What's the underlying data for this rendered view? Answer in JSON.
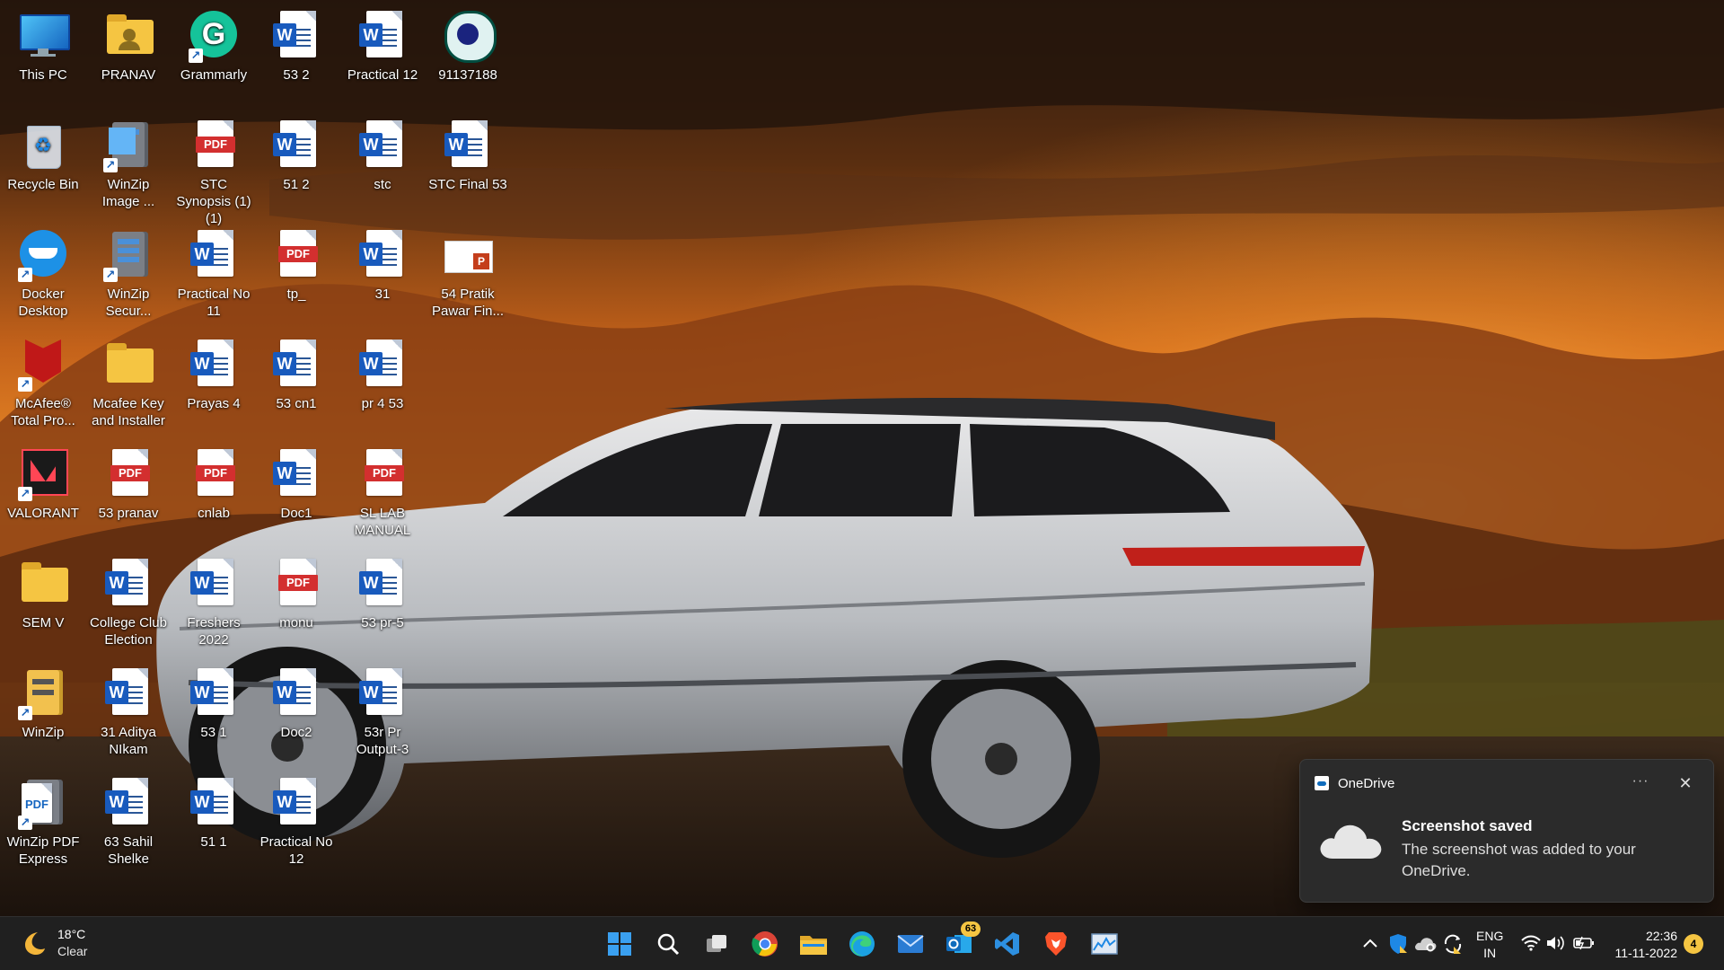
{
  "desktop": {
    "icons": [
      {
        "label": "This PC",
        "kind": "monitor-icon"
      },
      {
        "label": "PRANAV",
        "kind": "user-folder-icon"
      },
      {
        "label": "Grammarly",
        "kind": "grammarly-icon"
      },
      {
        "label": "53 2",
        "kind": "word-icon"
      },
      {
        "label": "Practical  12",
        "kind": "word-icon"
      },
      {
        "label": "91137188",
        "kind": "badge-image-icon"
      },
      {
        "label": "Recycle Bin",
        "kind": "recycle-bin-icon"
      },
      {
        "label": "WinZip Image ...",
        "kind": "winzip-image-icon"
      },
      {
        "label": "STC Synopsis (1) (1)",
        "kind": "pdf-icon"
      },
      {
        "label": "51 2",
        "kind": "word-icon"
      },
      {
        "label": "stc",
        "kind": "word-icon"
      },
      {
        "label": "STC Final 53",
        "kind": "word-icon"
      },
      {
        "label": "Docker Desktop",
        "kind": "docker-icon"
      },
      {
        "label": "WinZip Secur...",
        "kind": "winzip-secure-icon"
      },
      {
        "label": "Practical No 11",
        "kind": "word-icon"
      },
      {
        "label": "tp_",
        "kind": "pdf-icon"
      },
      {
        "label": "31",
        "kind": "word-icon"
      },
      {
        "label": "54 Pratik Pawar Fin...",
        "kind": "powerpoint-icon"
      },
      {
        "label": "McAfee® Total Pro...",
        "kind": "mcafee-icon"
      },
      {
        "label": "Mcafee Key and Installer",
        "kind": "folder-icon"
      },
      {
        "label": "Prayas 4",
        "kind": "word-icon"
      },
      {
        "label": "53 cn1",
        "kind": "word-icon"
      },
      {
        "label": "pr 4 53",
        "kind": "word-icon"
      },
      {
        "label": "VALORANT",
        "kind": "valorant-icon"
      },
      {
        "label": "53 pranav",
        "kind": "pdf-icon"
      },
      {
        "label": "cnlab",
        "kind": "pdf-icon"
      },
      {
        "label": "Doc1",
        "kind": "word-icon"
      },
      {
        "label": "SL LAB MANUAL",
        "kind": "pdf-icon"
      },
      {
        "label": "SEM V",
        "kind": "folder-icon"
      },
      {
        "label": "College Club Election",
        "kind": "word-icon"
      },
      {
        "label": "Freshers 2022",
        "kind": "word-icon"
      },
      {
        "label": "monu",
        "kind": "pdf-icon"
      },
      {
        "label": "53 pr-5",
        "kind": "word-icon"
      },
      {
        "label": "WinZip",
        "kind": "winzip-icon"
      },
      {
        "label": "31 Aditya NIkam",
        "kind": "word-icon"
      },
      {
        "label": "53 1",
        "kind": "word-icon"
      },
      {
        "label": "Doc2",
        "kind": "word-icon"
      },
      {
        "label": "53r Pr Output-3",
        "kind": "word-icon"
      },
      {
        "label": "WinZip PDF Express",
        "kind": "winzip-pdf-icon"
      },
      {
        "label": "63 Sahil Shelke",
        "kind": "word-icon"
      },
      {
        "label": "51 1",
        "kind": "word-icon"
      },
      {
        "label": "Practical No 12",
        "kind": "word-icon"
      }
    ]
  },
  "toast": {
    "app_name": "OneDrive",
    "title": "Screenshot saved",
    "body": "The screenshot was added to your OneDrive.",
    "more_label": "···",
    "close_label": "✕"
  },
  "taskbar": {
    "weather": {
      "temp": "18°C",
      "condition": "Clear"
    },
    "pinned": [
      {
        "name": "start-button",
        "icon": "windows-logo-icon"
      },
      {
        "name": "search-button",
        "icon": "search-icon"
      },
      {
        "name": "task-view-button",
        "icon": "task-view-icon"
      },
      {
        "name": "chrome-button",
        "icon": "chrome-icon"
      },
      {
        "name": "file-explorer-button",
        "icon": "folder-icon"
      },
      {
        "name": "edge-button",
        "icon": "edge-icon"
      },
      {
        "name": "mail-button",
        "icon": "mail-icon"
      },
      {
        "name": "outlook-button",
        "icon": "outlook-icon",
        "badge": "63"
      },
      {
        "name": "vscode-button",
        "icon": "vscode-icon"
      },
      {
        "name": "brave-button",
        "icon": "brave-icon"
      },
      {
        "name": "monitor-app-button",
        "icon": "chart-icon"
      }
    ],
    "tray": {
      "language_line1": "ENG",
      "language_line2": "IN",
      "time": "22:36",
      "date": "11-11-2022",
      "notification_count": "4"
    }
  },
  "colors": {
    "taskbar_bg": "#202020",
    "toast_bg": "#2b2b2b",
    "sky_top": "#2b1a10",
    "sky_glow": "#f08a24",
    "accent": "#0f6cbd"
  }
}
